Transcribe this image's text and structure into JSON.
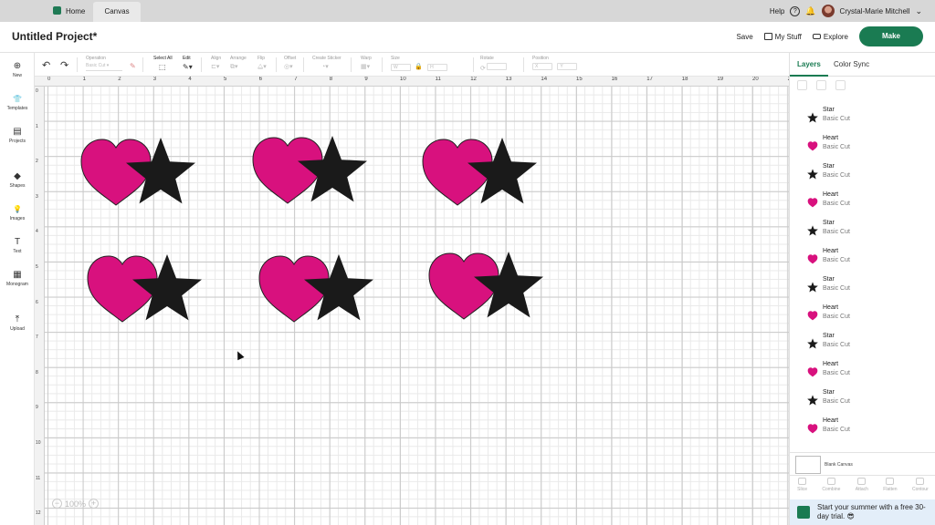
{
  "topbar": {
    "tabs": [
      {
        "label": "Home"
      },
      {
        "label": "Canvas"
      }
    ],
    "help_label": "Help",
    "help_icon_text": "?",
    "user_name": "Crystal-Marie Mitchell",
    "chevron": "⌄"
  },
  "header": {
    "project_title": "Untitled Project*",
    "save_label": "Save",
    "my_stuff_label": "My Stuff",
    "explore_label": "Explore",
    "make_label": "Make"
  },
  "toolbar": {
    "undo": "↶",
    "redo": "↷",
    "operation_label": "Operation",
    "operation_value": "Basic Cut",
    "select_all_label": "Select All",
    "edit_label": "Edit",
    "align_label": "Align",
    "arrange_label": "Arrange",
    "flip_label": "Flip",
    "offset_label": "Offset",
    "create_sticker_label": "Create Sticker",
    "warp_label": "Warp",
    "size_label": "Size",
    "size_w": "W",
    "size_h": "H",
    "rotate_label": "Rotate",
    "position_label": "Position",
    "pos_x": "X",
    "pos_y": "Y"
  },
  "sidebar": {
    "items": [
      {
        "label": "New",
        "icon": "plus-circle-icon",
        "glyph": "⊕"
      },
      {
        "label": "Templates",
        "icon": "shirt-icon",
        "glyph": "👕"
      },
      {
        "label": "Projects",
        "icon": "projects-icon",
        "glyph": "▤"
      },
      {
        "label": "Shapes",
        "icon": "shapes-icon",
        "glyph": "◆"
      },
      {
        "label": "Images",
        "icon": "bulb-icon",
        "glyph": "💡"
      },
      {
        "label": "Text",
        "icon": "text-icon",
        "glyph": "T"
      },
      {
        "label": "Monogram",
        "icon": "monogram-icon",
        "glyph": "▦"
      },
      {
        "label": "Upload",
        "icon": "upload-icon",
        "glyph": "⤒"
      }
    ]
  },
  "rulers": {
    "top": [
      "0",
      "1",
      "2",
      "3",
      "4",
      "5",
      "6",
      "7",
      "8",
      "9",
      "10",
      "11",
      "12",
      "13",
      "14",
      "15",
      "16",
      "17",
      "18",
      "19",
      "20",
      "21"
    ],
    "left": [
      "0",
      "1",
      "2",
      "3",
      "4",
      "5",
      "6",
      "7",
      "8",
      "9",
      "10",
      "11",
      "12"
    ]
  },
  "canvas": {
    "zoom_label": "100%",
    "zoom_minus": "−",
    "zoom_plus": "+",
    "heart_color": "#d8117e",
    "star_color": "#1a1a1a"
  },
  "layers_panel": {
    "tabs": [
      {
        "label": "Layers"
      },
      {
        "label": "Color Sync"
      }
    ],
    "layers": [
      {
        "name": "Star",
        "operation": "Basic Cut",
        "shape": "star"
      },
      {
        "name": "Heart",
        "operation": "Basic Cut",
        "shape": "heart"
      },
      {
        "name": "Star",
        "operation": "Basic Cut",
        "shape": "star"
      },
      {
        "name": "Heart",
        "operation": "Basic Cut",
        "shape": "heart"
      },
      {
        "name": "Star",
        "operation": "Basic Cut",
        "shape": "star"
      },
      {
        "name": "Heart",
        "operation": "Basic Cut",
        "shape": "heart"
      },
      {
        "name": "Star",
        "operation": "Basic Cut",
        "shape": "star"
      },
      {
        "name": "Heart",
        "operation": "Basic Cut",
        "shape": "heart"
      },
      {
        "name": "Star",
        "operation": "Basic Cut",
        "shape": "star"
      },
      {
        "name": "Heart",
        "operation": "Basic Cut",
        "shape": "heart"
      },
      {
        "name": "Star",
        "operation": "Basic Cut",
        "shape": "star"
      },
      {
        "name": "Heart",
        "operation": "Basic Cut",
        "shape": "heart"
      }
    ],
    "blank_canvas_label": "Blank Canvas",
    "bottom_actions": [
      {
        "label": "Slice"
      },
      {
        "label": "Combine"
      },
      {
        "label": "Attach"
      },
      {
        "label": "Flatten"
      },
      {
        "label": "Contour"
      }
    ],
    "promo_text": "Start your summer with a free 30-day trial. 😎"
  }
}
